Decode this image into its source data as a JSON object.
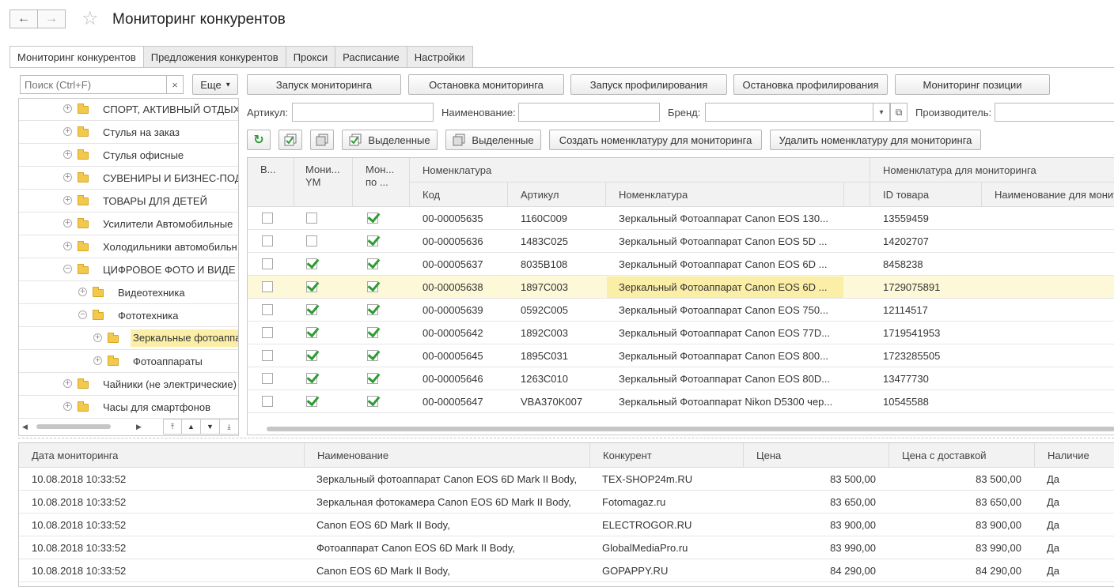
{
  "window": {
    "title": "Мониторинг конкурентов"
  },
  "tabs": [
    "Мониторинг конкурентов",
    "Предложения конкурентов",
    "Прокси",
    "Расписание",
    "Настройки"
  ],
  "search": {
    "placeholder": "Поиск (Ctrl+F)",
    "clear": "×",
    "more": "Еще",
    "more_arrow": "▾"
  },
  "actions": [
    "Запуск мониторинга",
    "Остановка мониторинга",
    "Запуск профилирования",
    "Остановка профилирования",
    "Мониторинг позиции"
  ],
  "filters": {
    "article": "Артикул:",
    "name": "Наименование:",
    "brand": "Бренд:",
    "maker": "Производитель:"
  },
  "toolbar": {
    "selected_on": "Выделенные",
    "selected_off": "Выделенные",
    "create": "Создать номенклатуру для мониторинга",
    "remove": "Удалить номенклатуру для мониторинга"
  },
  "tree": [
    {
      "label": "СПОРТ, АКТИВНЫЙ ОТДЫХ",
      "level": 0,
      "sign": "+"
    },
    {
      "label": "Стулья на заказ",
      "level": 0,
      "sign": "+"
    },
    {
      "label": "Стулья офисные",
      "level": 0,
      "sign": "+"
    },
    {
      "label": "СУВЕНИРЫ И БИЗНЕС-ПОД",
      "level": 0,
      "sign": "+"
    },
    {
      "label": "ТОВАРЫ ДЛЯ ДЕТЕЙ",
      "level": 0,
      "sign": "+"
    },
    {
      "label": "Усилители Автомобильные",
      "level": 0,
      "sign": "+"
    },
    {
      "label": "Холодильники автомобильн",
      "level": 0,
      "sign": "+"
    },
    {
      "label": "ЦИФРОВОЕ ФОТО И ВИДЕ",
      "level": 0,
      "sign": "−"
    },
    {
      "label": "Видеотехника",
      "level": 1,
      "sign": "+"
    },
    {
      "label": "Фототехника",
      "level": 1,
      "sign": "−"
    },
    {
      "label": "Зеркальные фотоаппа",
      "level": 2,
      "sign": "+",
      "selected": true
    },
    {
      "label": "Фотоаппараты",
      "level": 2,
      "sign": "+"
    },
    {
      "label": "Чайники (не электрические)",
      "level": 0,
      "sign": "+"
    },
    {
      "label": "Часы для смартфонов",
      "level": 0,
      "sign": "+"
    }
  ],
  "grid": {
    "headers": {
      "v": "В...",
      "ym": "Мони...\nYM",
      "po": "Мон...\nпо ...",
      "nom_group": "Номенклатура",
      "code": "Код",
      "article": "Артикул",
      "nom": "Номенклатура",
      "mon_group": "Номенклатура для мониторинга",
      "id": "ID товара",
      "mon_name": "Наименование для монит"
    },
    "rows": [
      {
        "v": false,
        "ym": false,
        "po": true,
        "code": "00-00005635",
        "article": "1160C009",
        "name": "Зеркальный Фотоаппарат Canon EOS 130...",
        "id": "13559459"
      },
      {
        "v": false,
        "ym": false,
        "po": true,
        "code": "00-00005636",
        "article": "1483C025",
        "name": "Зеркальный Фотоаппарат Canon EOS 5D ...",
        "id": "14202707"
      },
      {
        "v": false,
        "ym": true,
        "po": true,
        "code": "00-00005637",
        "article": "8035B108",
        "name": "Зеркальный Фотоаппарат Canon EOS 6D ...",
        "id": "8458238"
      },
      {
        "v": false,
        "ym": true,
        "po": true,
        "code": "00-00005638",
        "article": "1897C003",
        "name": "Зеркальный Фотоаппарат Canon EOS 6D ...",
        "id": "1729075891",
        "selected": true
      },
      {
        "v": false,
        "ym": true,
        "po": true,
        "code": "00-00005639",
        "article": "0592C005",
        "name": "Зеркальный Фотоаппарат Canon EOS 750...",
        "id": "12114517"
      },
      {
        "v": false,
        "ym": true,
        "po": true,
        "code": "00-00005642",
        "article": "1892C003",
        "name": "Зеркальный Фотоаппарат Canon EOS 77D...",
        "id": "1719541953"
      },
      {
        "v": false,
        "ym": true,
        "po": true,
        "code": "00-00005645",
        "article": "1895C031",
        "name": "Зеркальный Фотоаппарат Canon EOS 800...",
        "id": "1723285505"
      },
      {
        "v": false,
        "ym": true,
        "po": true,
        "code": "00-00005646",
        "article": "1263C010",
        "name": "Зеркальный Фотоаппарат Canon EOS 80D...",
        "id": "13477730"
      },
      {
        "v": false,
        "ym": true,
        "po": true,
        "code": "00-00005647",
        "article": "VBA370K007",
        "name": "Зеркальный Фотоаппарат Nikon D5300 чер...",
        "id": "10545588"
      }
    ]
  },
  "offers": {
    "headers": [
      "Дата мониторинга",
      "Наименование",
      "Конкурент",
      "Цена",
      "Цена с доставкой",
      "Наличие"
    ],
    "rows": [
      [
        "10.08.2018 10:33:52",
        "Зеркальный фотоаппарат Canon EOS 6D Mark II Body,",
        "TEX-SHOP24m.RU",
        "83 500,00",
        "83 500,00",
        "Да"
      ],
      [
        "10.08.2018 10:33:52",
        "Зеркальная фотокамера Canon EOS 6D Mark II Body,",
        "Fotomagaz.ru",
        "83 650,00",
        "83 650,00",
        "Да"
      ],
      [
        "10.08.2018 10:33:52",
        "Canon EOS 6D Mark II Body,",
        "ELECTROGOR.RU",
        "83 900,00",
        "83 900,00",
        "Да"
      ],
      [
        "10.08.2018 10:33:52",
        "Фотоаппарат Canon EOS 6D Mark II Body,",
        "GlobalMediaPro.ru",
        "83 990,00",
        "83 990,00",
        "Да"
      ],
      [
        "10.08.2018 10:33:52",
        "Canon EOS 6D Mark II Body,",
        "GOPAPPY.RU",
        "84 290,00",
        "84 290,00",
        "Да"
      ]
    ]
  },
  "icons": {
    "back": "←",
    "forward": "→",
    "star": "☆",
    "refresh": "↻",
    "pick": "▾",
    "open": "⧉"
  },
  "colors": {
    "accent_selection": "#fbeea7",
    "check": "#2e9b34"
  }
}
